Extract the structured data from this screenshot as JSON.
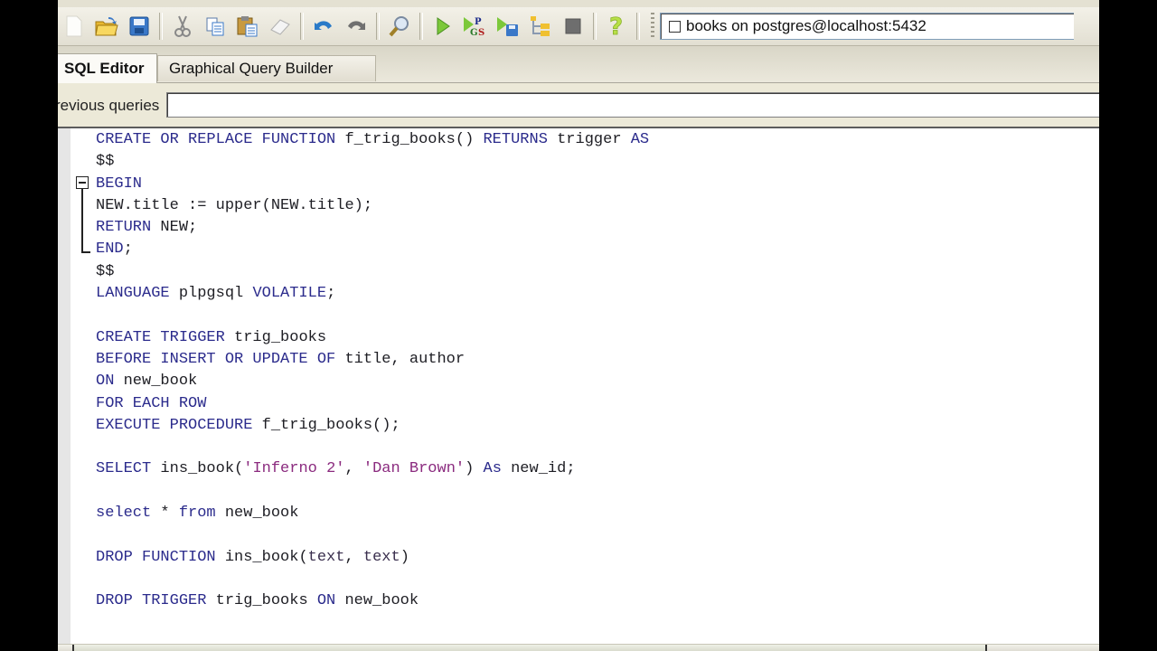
{
  "toolbar": {
    "buttons": [
      {
        "name": "new-file",
        "icon": "new-document-icon"
      },
      {
        "name": "open-file",
        "icon": "open-folder-icon"
      },
      {
        "name": "save-file",
        "icon": "save-disk-icon"
      },
      {
        "name": "cut",
        "icon": "scissors-icon"
      },
      {
        "name": "copy",
        "icon": "copy-icon"
      },
      {
        "name": "paste",
        "icon": "paste-icon"
      },
      {
        "name": "clear",
        "icon": "eraser-icon"
      },
      {
        "name": "undo",
        "icon": "undo-icon"
      },
      {
        "name": "redo",
        "icon": "redo-icon"
      },
      {
        "name": "find",
        "icon": "magnifier-icon"
      },
      {
        "name": "execute",
        "icon": "play-icon"
      },
      {
        "name": "execute-pgscript",
        "icon": "play-pgs-icon"
      },
      {
        "name": "execute-to-file",
        "icon": "play-save-icon"
      },
      {
        "name": "explain",
        "icon": "explain-tree-icon"
      },
      {
        "name": "cancel",
        "icon": "stop-icon"
      },
      {
        "name": "help",
        "icon": "help-question-icon"
      }
    ],
    "connection": {
      "label": "books on postgres@localhost:5432"
    }
  },
  "tabs": [
    {
      "label": "SQL Editor",
      "active": true
    },
    {
      "label": "Graphical Query Builder",
      "active": false
    }
  ],
  "previous_queries": {
    "label": "revious queries",
    "value": ""
  },
  "editor": {
    "colors": {
      "keyword": "#2b2b8c",
      "identifier": "#1e1e24",
      "string": "#8b2b7f"
    },
    "lines": [
      [
        {
          "t": "CREATE OR REPLACE FUNCTION",
          "c": "kw"
        },
        {
          "t": " f_trig_books() ",
          "c": "id"
        },
        {
          "t": "RETURNS",
          "c": "kw"
        },
        {
          "t": " trigger ",
          "c": "id"
        },
        {
          "t": "AS",
          "c": "kw"
        }
      ],
      [
        {
          "t": "$$",
          "c": "id"
        }
      ],
      [
        {
          "t": "BEGIN",
          "c": "kw"
        }
      ],
      [
        {
          "t": "NEW.title := upper(NEW.title);",
          "c": "id"
        }
      ],
      [
        {
          "t": "RETURN",
          "c": "kw"
        },
        {
          "t": " NEW;",
          "c": "id"
        }
      ],
      [
        {
          "t": "END",
          "c": "kw"
        },
        {
          "t": ";",
          "c": "id"
        }
      ],
      [
        {
          "t": "$$",
          "c": "id"
        }
      ],
      [
        {
          "t": "LANGUAGE",
          "c": "kw"
        },
        {
          "t": " plpgsql ",
          "c": "id"
        },
        {
          "t": "VOLATILE",
          "c": "kw"
        },
        {
          "t": ";",
          "c": "id"
        }
      ],
      [],
      [
        {
          "t": "CREATE TRIGGER",
          "c": "kw"
        },
        {
          "t": " trig_books",
          "c": "id"
        }
      ],
      [
        {
          "t": "BEFORE INSERT OR UPDATE OF",
          "c": "kw"
        },
        {
          "t": " title, author",
          "c": "id"
        }
      ],
      [
        {
          "t": "ON",
          "c": "kw"
        },
        {
          "t": " new_book",
          "c": "id"
        }
      ],
      [
        {
          "t": "FOR EACH ROW",
          "c": "kw"
        }
      ],
      [
        {
          "t": "EXECUTE PROCEDURE",
          "c": "kw"
        },
        {
          "t": " f_trig_books();",
          "c": "id"
        }
      ],
      [],
      [
        {
          "t": "SELECT",
          "c": "kw"
        },
        {
          "t": " ins_book(",
          "c": "id"
        },
        {
          "t": "'Inferno 2'",
          "c": "str"
        },
        {
          "t": ", ",
          "c": "id"
        },
        {
          "t": "'Dan Brown'",
          "c": "str"
        },
        {
          "t": ") ",
          "c": "id"
        },
        {
          "t": "As",
          "c": "kw"
        },
        {
          "t": " new_id;",
          "c": "id"
        }
      ],
      [],
      [
        {
          "t": "select",
          "c": "kw"
        },
        {
          "t": " * ",
          "c": "id"
        },
        {
          "t": "from",
          "c": "kw"
        },
        {
          "t": " new_book",
          "c": "id"
        }
      ],
      [],
      [
        {
          "t": "DROP FUNCTION",
          "c": "kw"
        },
        {
          "t": " ins_book(",
          "c": "id"
        },
        {
          "t": "text",
          "c": "typ"
        },
        {
          "t": ", ",
          "c": "id"
        },
        {
          "t": "text",
          "c": "typ"
        },
        {
          "t": ")",
          "c": "id"
        }
      ],
      [],
      [
        {
          "t": "DROP TRIGGER",
          "c": "kw"
        },
        {
          "t": " trig_books ",
          "c": "id"
        },
        {
          "t": "ON",
          "c": "kw"
        },
        {
          "t": " new_book",
          "c": "id"
        }
      ]
    ]
  }
}
